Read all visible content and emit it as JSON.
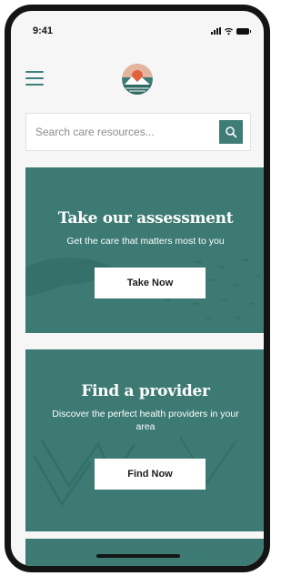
{
  "status_bar": {
    "time": "9:41"
  },
  "header": {
    "menu_icon": "hamburger-menu-icon",
    "logo_icon": "sunset-mountain-logo-icon"
  },
  "search": {
    "placeholder": "Search care resources...",
    "icon": "search-icon"
  },
  "cards": [
    {
      "title": "Take our assessment",
      "subtitle": "Get the care that matters most to you",
      "button": "Take Now"
    },
    {
      "title": "Find a provider",
      "subtitle": "Discover the perfect health providers in your area",
      "button": "Find Now"
    }
  ],
  "colors": {
    "accent": "#3c7a73",
    "background": "#f6f6f6",
    "phone_frame": "#141414"
  }
}
